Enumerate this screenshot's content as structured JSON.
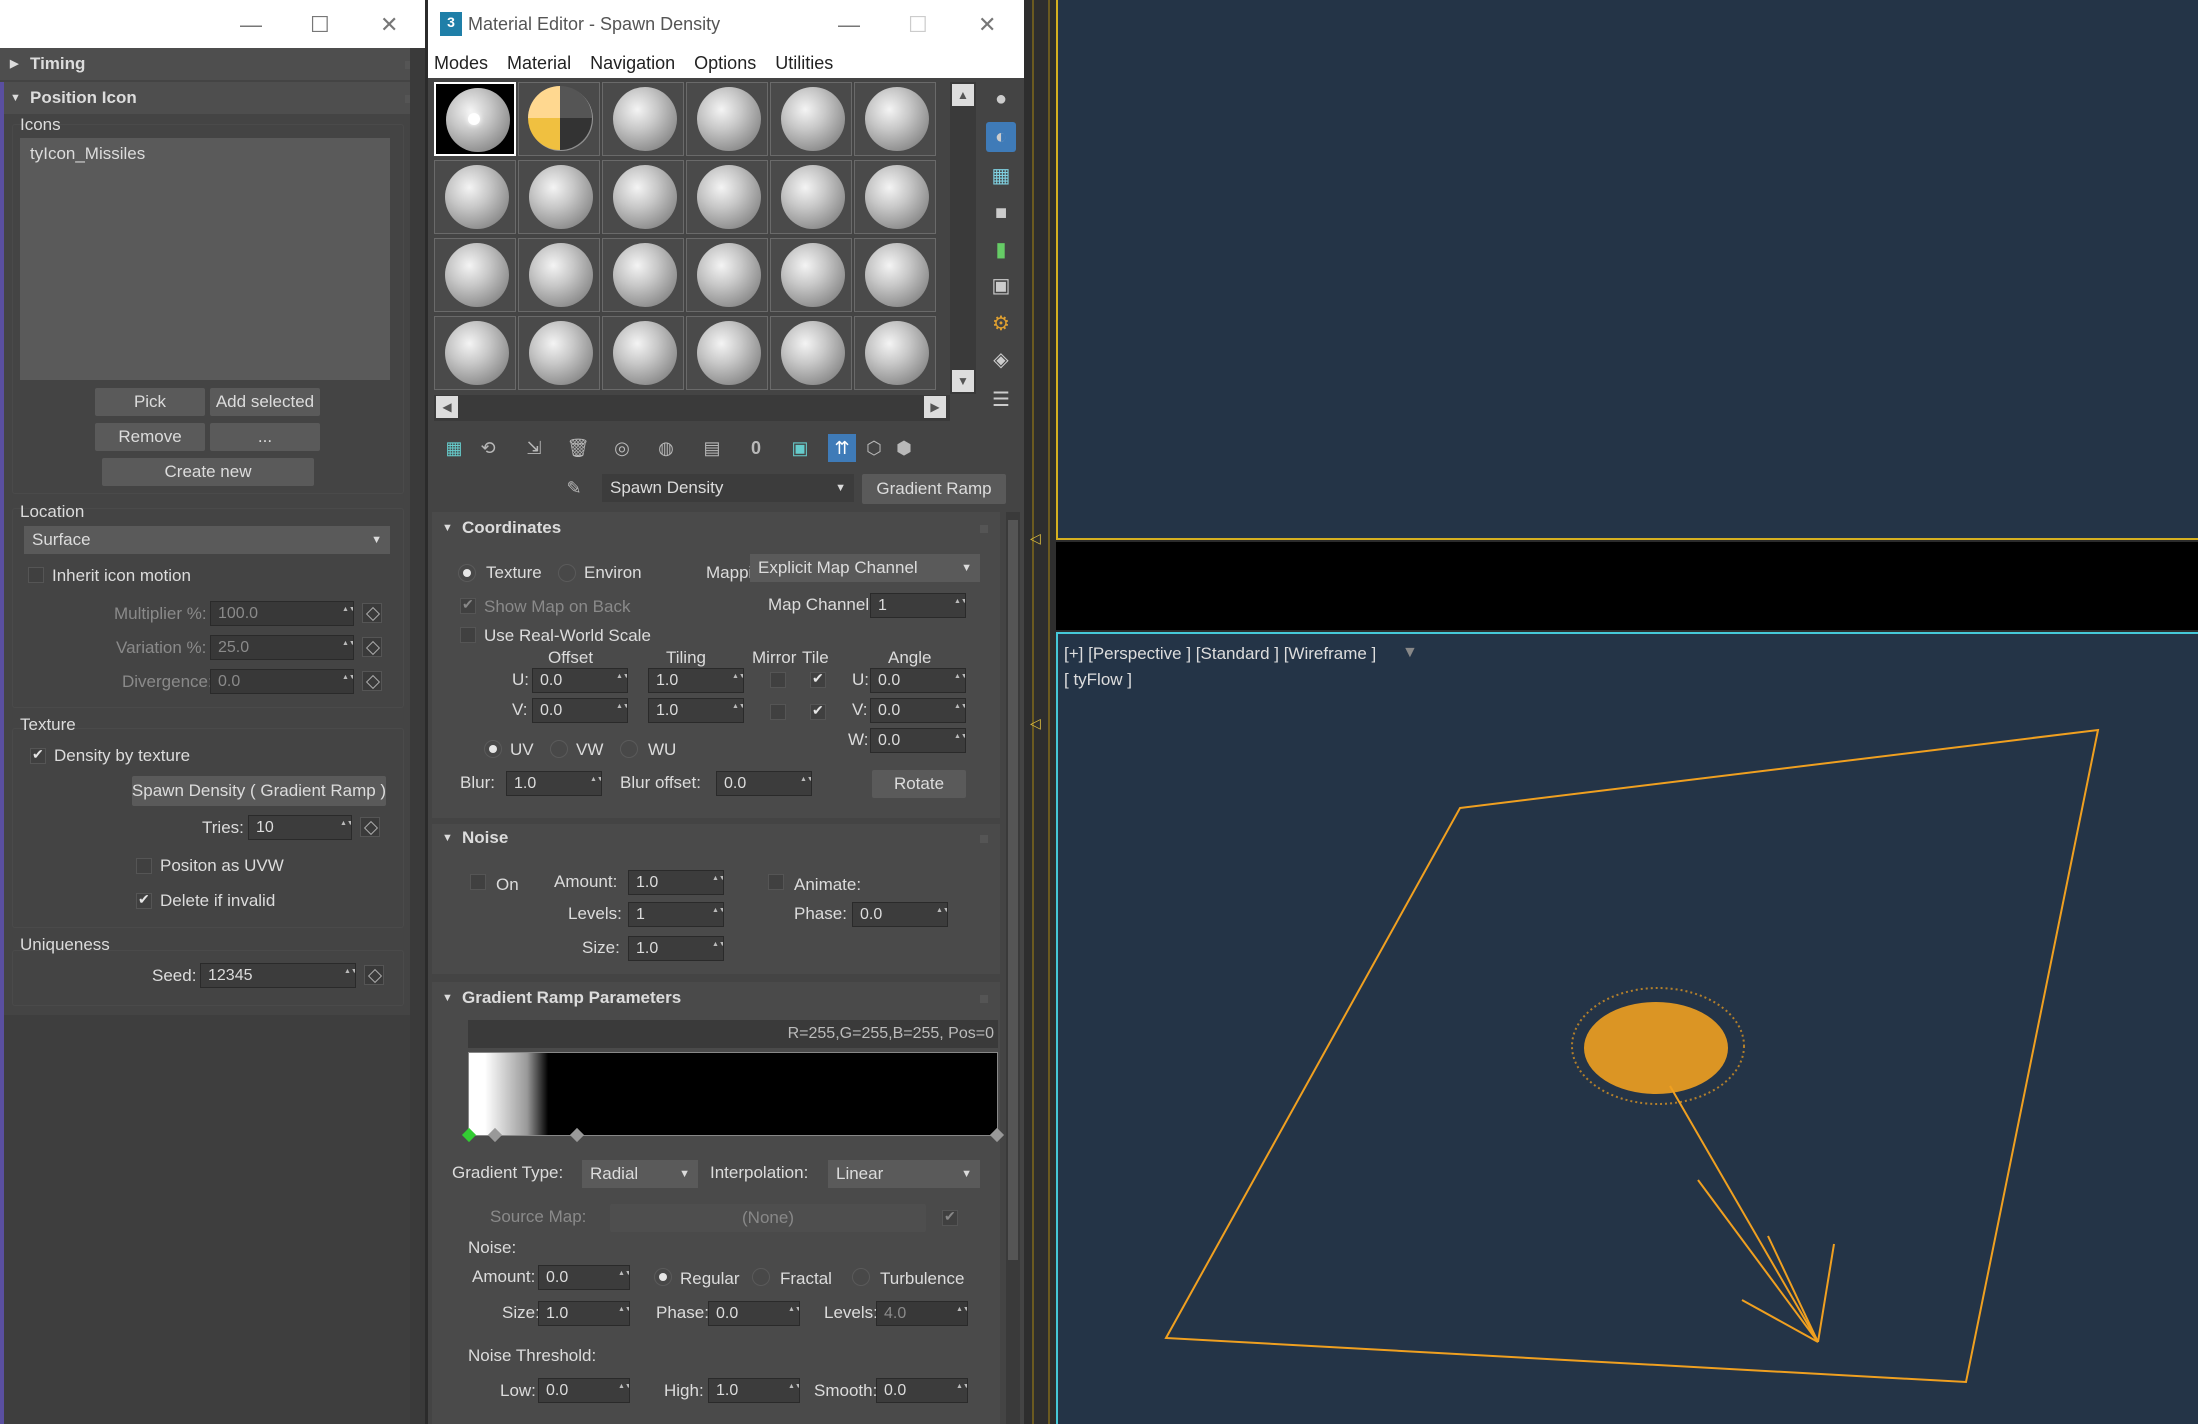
{
  "left_panel": {
    "rollouts": {
      "timing": "Timing",
      "position_icon": "Position Icon"
    },
    "icons_group": {
      "label": "Icons",
      "items": [
        "tyIcon_Missiles"
      ],
      "pick": "Pick",
      "add_selected": "Add selected",
      "remove": "Remove",
      "more": "...",
      "create_new": "Create new"
    },
    "location": {
      "label": "Location",
      "value": "Surface",
      "inherit_label": "Inherit icon motion",
      "multiplier_label": "Multiplier %:",
      "multiplier_value": "100.0",
      "variation_label": "Variation %:",
      "variation_value": "25.0",
      "divergence_label": "Divergence:",
      "divergence_value": "0.0"
    },
    "texture": {
      "label": "Texture",
      "density_label": "Density by texture",
      "map_button": "Spawn Density  ( Gradient Ramp )",
      "tries_label": "Tries:",
      "tries_value": "10",
      "position_uvw": "Positon as UVW",
      "delete_invalid": "Delete if invalid"
    },
    "uniqueness": {
      "label": "Uniqueness",
      "seed_label": "Seed:",
      "seed_value": "12345"
    }
  },
  "material_editor": {
    "title": "Material Editor - Spawn Density",
    "menu": [
      "Modes",
      "Material",
      "Navigation",
      "Options",
      "Utilities"
    ],
    "material_name": "Spawn Density",
    "map_type": "Gradient Ramp",
    "coordinates": {
      "header": "Coordinates",
      "texture": "Texture",
      "environ": "Environ",
      "mapping_label": "Mapping:",
      "mapping_value": "Explicit Map Channel",
      "show_map_back": "Show Map on Back",
      "map_channel_label": "Map Channel:",
      "map_channel_value": "1",
      "real_world": "Use Real-World Scale",
      "offset": "Offset",
      "tiling": "Tiling",
      "mirror": "Mirror",
      "tile": "Tile",
      "angle": "Angle",
      "u_label": "U:",
      "v_label": "V:",
      "w_label": "W:",
      "u_offset": "0.0",
      "v_offset": "0.0",
      "u_tiling": "1.0",
      "v_tiling": "1.0",
      "u_angle": "0.0",
      "v_angle": "0.0",
      "w_angle": "0.0",
      "uv": "UV",
      "vw": "VW",
      "wu": "WU",
      "blur_label": "Blur:",
      "blur_value": "1.0",
      "blur_offset_label": "Blur offset:",
      "blur_offset_value": "0.0",
      "rotate": "Rotate"
    },
    "noise": {
      "header": "Noise",
      "on": "On",
      "amount_label": "Amount:",
      "amount_value": "1.0",
      "levels_label": "Levels:",
      "levels_value": "1",
      "size_label": "Size:",
      "size_value": "1.0",
      "animate": "Animate:",
      "phase_label": "Phase:",
      "phase_value": "0.0"
    },
    "gradient_ramp": {
      "header": "Gradient Ramp Parameters",
      "flag_info": "R=255,G=255,B=255, Pos=0",
      "gradient_type_label": "Gradient Type:",
      "gradient_type_value": "Radial",
      "interpolation_label": "Interpolation:",
      "interpolation_value": "Linear",
      "source_map_label": "Source Map:",
      "source_map_value": "(None)",
      "noise_label": "Noise:",
      "amount_label": "Amount:",
      "amount_value": "0.0",
      "regular": "Regular",
      "fractal": "Fractal",
      "turbulence": "Turbulence",
      "size_label": "Size:",
      "size_value": "1.0",
      "phase_label": "Phase:",
      "phase_value": "0.0",
      "levels_label": "Levels:",
      "levels_value": "4.0",
      "threshold_label": "Noise Threshold:",
      "low_label": "Low:",
      "low_value": "0.0",
      "high_label": "High:",
      "high_value": "1.0",
      "smooth_label": "Smooth:",
      "smooth_value": "0.0"
    }
  },
  "viewport": {
    "label": "[+] [Perspective ] [Standard ] [Wireframe ]",
    "sublabel": "[ tyFlow ]"
  },
  "colors": {
    "viewport_bg": "#243447",
    "accent_orange": "#f0a020",
    "active_border": "#45c8d8"
  }
}
